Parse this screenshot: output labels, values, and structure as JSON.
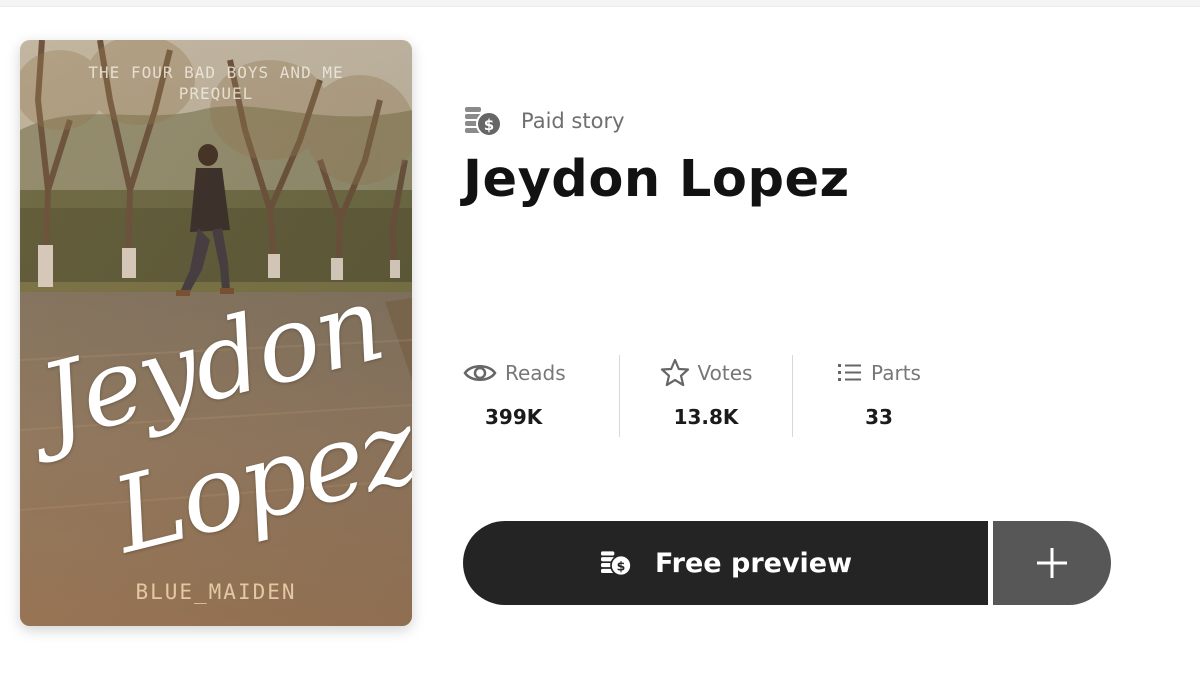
{
  "cover": {
    "series_line1": "The Four Bad Boys and Me",
    "series_line2": "Prequel",
    "script_first": "Jeydon",
    "script_last": "Lopez",
    "author": "BLUE_MAIDEN"
  },
  "story": {
    "paid_label": "Paid story",
    "title": "Jeydon Lopez"
  },
  "stats": {
    "reads_label": "Reads",
    "reads_value": "399K",
    "votes_label": "Votes",
    "votes_value": "13.8K",
    "parts_label": "Parts",
    "parts_value": "33"
  },
  "actions": {
    "preview_label": "Free preview",
    "add_icon": "plus-icon"
  },
  "colors": {
    "button_dark": "#242424",
    "button_add": "#575757",
    "muted_text": "#6f6f6f"
  }
}
